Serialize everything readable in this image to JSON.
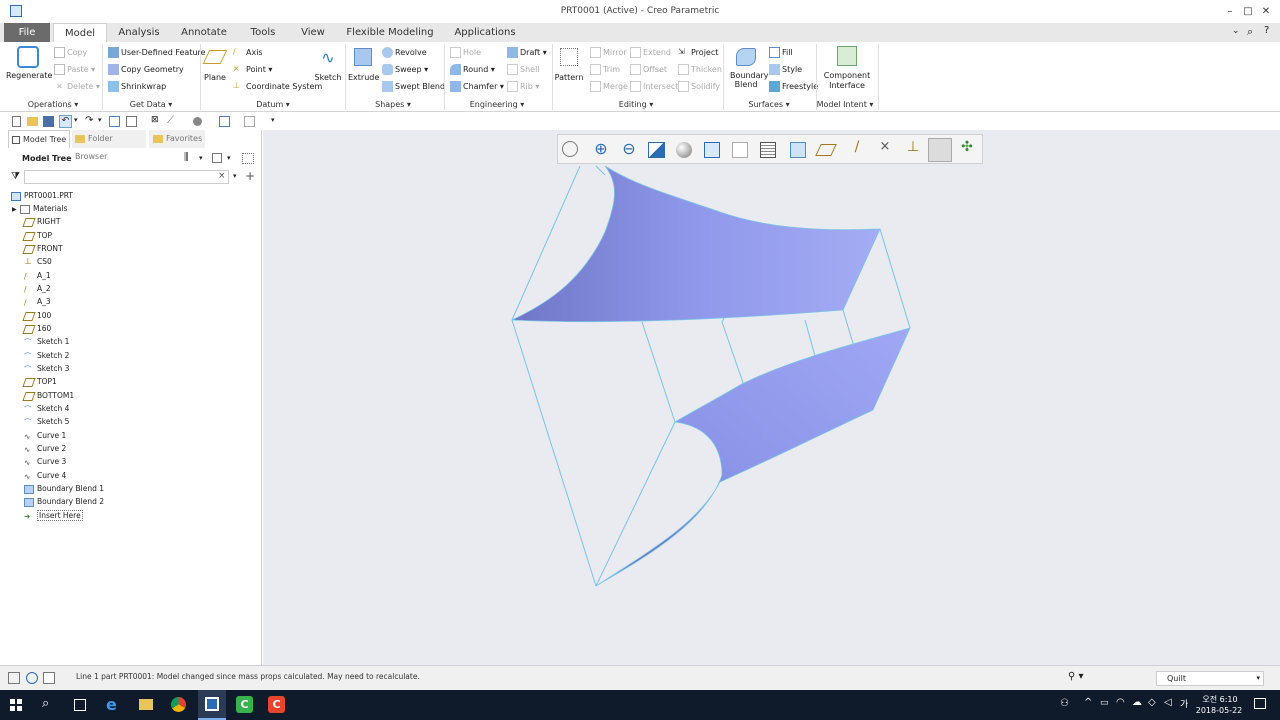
{
  "window": {
    "title": "PRT0001 (Active) - Creo Parametric"
  },
  "tabs": [
    "File",
    "Model",
    "Analysis",
    "Annotate",
    "Tools",
    "View",
    "Flexible Modeling",
    "Applications"
  ],
  "ribbon": {
    "regenerate": "Regenerate",
    "copy": "Copy",
    "paste": "Paste",
    "delete": "Delete",
    "user_defined_feature": "User-Defined Feature",
    "copy_geometry": "Copy Geometry",
    "shrinkwrap": "Shrinkwrap",
    "plane": "Plane",
    "axis": "Axis",
    "point": "Point",
    "coordinate_system": "Coordinate System",
    "sketch": "Sketch",
    "extrude": "Extrude",
    "revolve": "Revolve",
    "sweep": "Sweep",
    "swept_blend": "Swept Blend",
    "hole": "Hole",
    "round": "Round",
    "chamfer": "Chamfer",
    "draft": "Draft",
    "shell": "Shell",
    "rib": "Rib",
    "pattern": "Pattern",
    "mirror": "Mirror",
    "trim": "Trim",
    "merge": "Merge",
    "extend": "Extend",
    "offset": "Offset",
    "intersect": "Intersect",
    "project": "Project",
    "thicken": "Thicken",
    "solidify": "Solidify",
    "boundary_blend": "Boundary Blend",
    "fill": "Fill",
    "style": "Style",
    "freestyle": "Freestyle",
    "component_interface": "Component Interface",
    "groups": {
      "operations": "Operations",
      "get_data": "Get Data",
      "datum": "Datum",
      "shapes": "Shapes",
      "engineering": "Engineering",
      "editing": "Editing",
      "surfaces": "Surfaces",
      "model_intent": "Model Intent"
    }
  },
  "left_panel": {
    "tabs": [
      "Model Tree",
      "Folder Browser",
      "Favorites"
    ],
    "header": "Model Tree",
    "tree": [
      "PRT0001.PRT",
      "Materials",
      "RIGHT",
      "TOP",
      "FRONT",
      "CS0",
      "A_1",
      "A_2",
      "A_3",
      "100",
      "160",
      "Sketch 1",
      "Sketch 2",
      "Sketch 3",
      "TOP1",
      "BOTTOM1",
      "Sketch 4",
      "Sketch 5",
      "Curve 1",
      "Curve 2",
      "Curve 3",
      "Curve 4",
      "Boundary Blend 1",
      "Boundary Blend 2",
      "Insert Here"
    ]
  },
  "status": {
    "message": "Line 1 part PRT0001: Model changed since mass props calculated. May need to recalculate.",
    "filter": "Quilt"
  },
  "taskbar": {
    "time": "오전 6:10",
    "date": "2018-05-22"
  },
  "colors": {
    "surface": "#8f98ea",
    "surface_dark": "#5e63a8",
    "edge": "#79c3e6",
    "viewport_bg": "#e9ebf1"
  }
}
